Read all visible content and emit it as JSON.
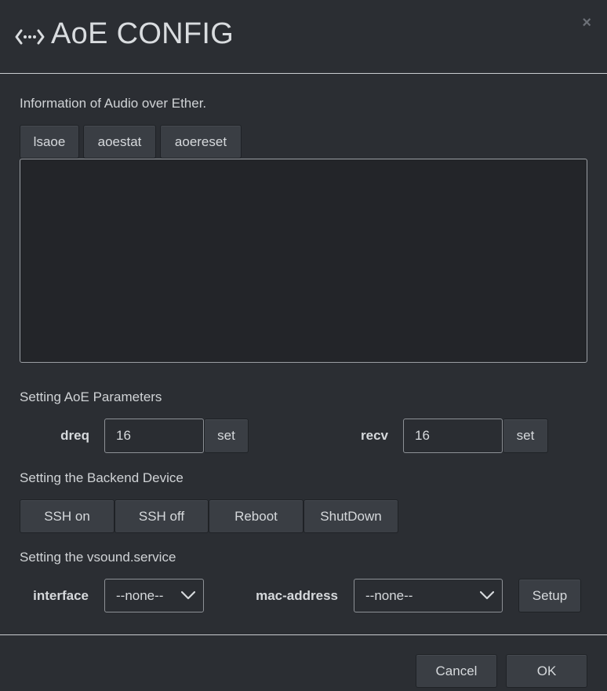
{
  "dialog": {
    "title": "AoE CONFIG",
    "title_icon": "ethernet-arrows-icon",
    "close_label": "×"
  },
  "info": {
    "heading": "Information of Audio over Ether.",
    "buttons": [
      "lsaoe",
      "aoestat",
      "aoereset"
    ],
    "output": ""
  },
  "params": {
    "heading": "Setting AoE Parameters",
    "dreq": {
      "label": "dreq",
      "value": "16",
      "set_label": "set"
    },
    "recv": {
      "label": "recv",
      "value": "16",
      "set_label": "set"
    }
  },
  "backend": {
    "heading": "Setting the Backend Device",
    "buttons": [
      "SSH on",
      "SSH off",
      "Reboot",
      "ShutDown"
    ]
  },
  "vsound": {
    "heading": "Setting the vsound.service",
    "interface": {
      "label": "interface",
      "selected": "--none--"
    },
    "mac": {
      "label": "mac-address",
      "selected": "--none--"
    },
    "setup_label": "Setup"
  },
  "footer": {
    "cancel_label": "Cancel",
    "ok_label": "OK"
  }
}
